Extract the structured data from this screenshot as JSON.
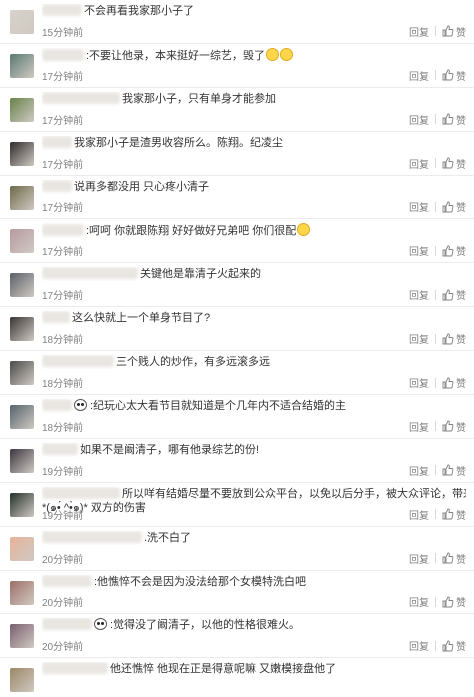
{
  "actions": {
    "reply": "回复",
    "like": "赞"
  },
  "comments": [
    {
      "text": "不会再看我家那小子了",
      "time": "15分钟前",
      "blur": 40,
      "gap": 0,
      "emoji": 0,
      "panda": false,
      "avatar_color": "#d7d2cb"
    },
    {
      "text": ":不要让他录，本来挺好一综艺，毁了",
      "text2": "",
      "time": "17分钟前",
      "blur": 42,
      "gap": 0,
      "emoji": 2,
      "panda": false,
      "avatar_color": "#5b7a73"
    },
    {
      "text": "我家那小子，只有单身才能参加",
      "text2": "",
      "time": "17分钟前",
      "blur": 78,
      "gap": 0,
      "emoji": 0,
      "panda": false,
      "avatar_color": "#67834a"
    },
    {
      "text": "我家那小子是渣男收容所么。陈翔。纪凌尘",
      "text2": "",
      "time": "17分钟前",
      "blur": 30,
      "gap": 0,
      "emoji": 0,
      "panda": false,
      "avatar_color": "#2f2a2c"
    },
    {
      "text": "说再多都没用 只心疼小清子",
      "text2": "",
      "time": "17分钟前",
      "blur": 30,
      "gap": 0,
      "emoji": 0,
      "panda": false,
      "avatar_color": "#6d6a4a"
    },
    {
      "text": ":呵呵 你就跟陈翔 好好做好兄弟吧 你们很配",
      "text2": "",
      "time": "17分钟前",
      "blur": 42,
      "gap": 0,
      "emoji": 1,
      "panda": false,
      "avatar_color": "#b89aa0"
    },
    {
      "text": "关键他是靠清子火起来的",
      "text2": "",
      "time": "17分钟前",
      "blur": 96,
      "gap": 0,
      "emoji": 0,
      "panda": false,
      "avatar_color": "#5a6068"
    },
    {
      "text": "这么快就上一个单身节目了?",
      "text2": "",
      "time": "18分钟前",
      "blur": 28,
      "gap": 0,
      "emoji": 0,
      "panda": false,
      "avatar_color": "#3a3535"
    },
    {
      "text": "三个贱人的炒作，有多远滚多远",
      "text2": "",
      "time": "18分钟前",
      "blur": 72,
      "gap": 0,
      "emoji": 0,
      "panda": false,
      "avatar_color": "#4a4a4a"
    },
    {
      "text": ":纪玩心太大看节目就知道是个几年内不适合结婚的主",
      "text2": "",
      "time": "18分钟前",
      "blur": 30,
      "gap": 0,
      "emoji": 0,
      "panda": true,
      "avatar_color": "#54636b"
    },
    {
      "text": "如果不是阚清子，哪有他录综艺的份!",
      "text2": "",
      "time": "19分钟前",
      "blur": 36,
      "gap": 0,
      "emoji": 0,
      "panda": false,
      "avatar_color": "#3b3540"
    },
    {
      "text": "所以咩有结婚尽量不要放到公众平台，以免以后分手，被大众评论，带来对",
      "text2": "*(๑•́ ^•̀๑)* 双方的伤害",
      "time": "19分钟前",
      "blur": 78,
      "gap": 0,
      "emoji": 0,
      "panda": false,
      "avatar_color": "#23302a"
    },
    {
      "text": ".洗不白了",
      "text2": "",
      "time": "20分钟前",
      "blur": 100,
      "gap": 0,
      "emoji": 0,
      "panda": false,
      "avatar_color": "#e7b39a"
    },
    {
      "text": ":他憔悴不会是因为没法给那个女模特洗白吧",
      "text2": "",
      "time": "20分钟前",
      "blur": 50,
      "gap": 0,
      "emoji": 0,
      "panda": false,
      "avatar_color": "#9e6f68"
    },
    {
      "text": ":觉得没了阚清子，以他的性格很难火。",
      "text2": "",
      "time": "20分钟前",
      "blur": 50,
      "gap": 0,
      "emoji": 0,
      "panda": true,
      "avatar_color": "#7a5e6e"
    },
    {
      "text": "他还憔悴 他现在正是得意呢嘛 又嫩模接盘他了",
      "text2": "",
      "time": "",
      "blur": 66,
      "gap": 0,
      "emoji": 0,
      "panda": false,
      "avatar_color": "#9b8766"
    }
  ]
}
